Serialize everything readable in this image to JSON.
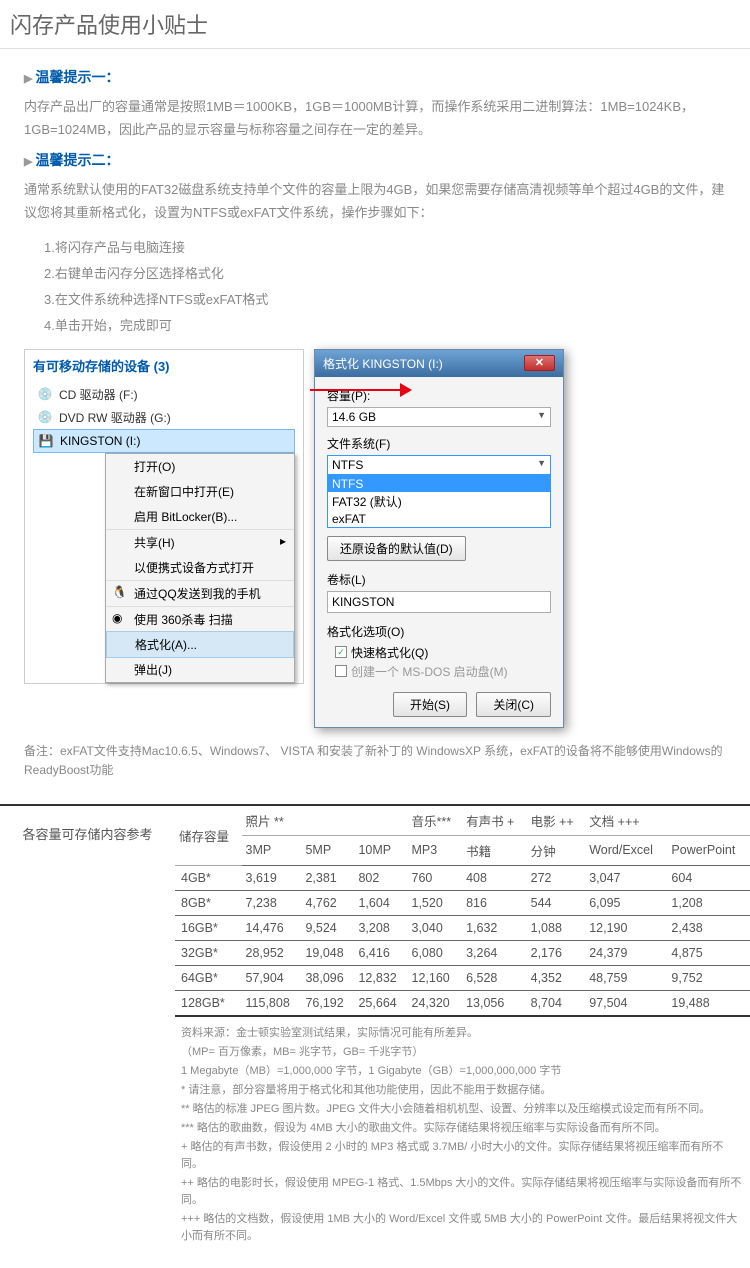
{
  "title": "闪存产品使用小贴士",
  "tip1_header": "温馨提示一：",
  "tip1_body": "内存产品出厂的容量通常是按照1MB＝1000KB，1GB＝1000MB计算，而操作系统采用二进制算法：1MB=1024KB，1GB=1024MB，因此产品的显示容量与标称容量之间存在一定的差异。",
  "tip2_header": "温馨提示二：",
  "tip2_body": "通常系统默认使用的FAT32磁盘系统支持单个文件的容量上限为4GB，如果您需要存储高清视频等单个超过4GB的文件，建议您将其重新格式化，设置为NTFS或exFAT文件系统，操作步骤如下：",
  "steps": [
    "1.将闪存产品与电脑连接",
    "2.右键单击闪存分区选择格式化",
    "3.在文件系统种选择NTFS或exFAT格式",
    "4.单击开始，完成即可"
  ],
  "devices_header": "有可移动存储的设备 (3)",
  "devices": [
    {
      "icon": "💿",
      "label": "CD 驱动器 (F:)"
    },
    {
      "icon": "💿",
      "label": "DVD RW 驱动器 (G:)"
    },
    {
      "icon": "💾",
      "label": "KINGSTON (I:)",
      "selected": true
    }
  ],
  "context_menu": [
    {
      "label": "打开(O)"
    },
    {
      "label": "在新窗口中打开(E)"
    },
    {
      "label": "启用 BitLocker(B)..."
    },
    {
      "label": "共享(H)",
      "arrow": "▸",
      "sep": true
    },
    {
      "label": "以便携式设备方式打开"
    },
    {
      "label": "通过QQ发送到我的手机",
      "icon": "🐧",
      "sep": true
    },
    {
      "label": "使用 360杀毒 扫描",
      "icon": "◉",
      "sep": true
    },
    {
      "label": "格式化(A)...",
      "highlight": true,
      "sep": true
    },
    {
      "label": "弹出(J)"
    }
  ],
  "dialog": {
    "title": "格式化 KINGSTON (I:)",
    "capacity_label": "容量(P):",
    "capacity_value": "14.6 GB",
    "fs_label": "文件系统(F)",
    "fs_value": "NTFS",
    "fs_options": [
      "NTFS",
      "FAT32 (默认)",
      "exFAT"
    ],
    "restore": "还原设备的默认值(D)",
    "volume_label": "卷标(L)",
    "volume_value": "KINGSTON",
    "options_label": "格式化选项(O)",
    "quick_format": "快速格式化(Q)",
    "quick_checked": true,
    "msdos": "创建一个 MS-DOS 启动盘(M)",
    "msdos_checked": false,
    "start": "开始(S)",
    "close": "关闭(C)"
  },
  "remark": "备注：exFAT文件支持Mac10.6.5、Windows7、 VISTA  和安装了新补丁的 WindowsXP 系统，exFAT的设备将不能够使用Windows的ReadyBoost功能",
  "table_label": "各容量可存储内容参考",
  "table": {
    "col0": "储存容量",
    "cats": [
      {
        "label": "照片 **",
        "sub": [
          "3MP",
          "5MP",
          "10MP"
        ]
      },
      {
        "label": "音乐***",
        "sub": [
          "MP3"
        ]
      },
      {
        "label": "有声书 +",
        "sub": [
          "书籍"
        ]
      },
      {
        "label": "电影 ++",
        "sub": [
          "分钟"
        ]
      },
      {
        "label": "文档 +++",
        "sub": [
          "Word/Excel",
          "PowerPoint"
        ]
      }
    ],
    "rows": [
      {
        "cap": "4GB*",
        "v": [
          "3,619",
          "2,381",
          "802",
          "760",
          "408",
          "272",
          "3,047",
          "604"
        ]
      },
      {
        "cap": "8GB*",
        "v": [
          "7,238",
          "4,762",
          "1,604",
          "1,520",
          "816",
          "544",
          "6,095",
          "1,208"
        ]
      },
      {
        "cap": "16GB*",
        "v": [
          "14,476",
          "9,524",
          "3,208",
          "3,040",
          "1,632",
          "1,088",
          "12,190",
          "2,438"
        ]
      },
      {
        "cap": "32GB*",
        "v": [
          "28,952",
          "19,048",
          "6,416",
          "6,080",
          "3,264",
          "2,176",
          "24,379",
          "4,875"
        ]
      },
      {
        "cap": "64GB*",
        "v": [
          "57,904",
          "38,096",
          "12,832",
          "12,160",
          "6,528",
          "4,352",
          "48,759",
          "9,752"
        ]
      },
      {
        "cap": "128GB*",
        "v": [
          "115,808",
          "76,192",
          "25,664",
          "24,320",
          "13,056",
          "8,704",
          "97,504",
          "19,488"
        ]
      }
    ]
  },
  "footnotes": [
    "资料来源：金士顿实验室测试结果，实际情况可能有所差异。",
    "（MP= 百万像素，MB= 兆字节，GB= 千兆字节）",
    "1 Megabyte（MB）=1,000,000 字节，1 Gigabyte（GB）=1,000,000,000 字节",
    "* 请注意，部分容量将用于格式化和其他功能使用，因此不能用于数据存储。",
    "** 略估的标准 JPEG 图片数。JPEG 文件大小会随着相机机型、设置、分辨率以及压缩模式设定而有所不同。",
    "*** 略估的歌曲数，假设为 4MB 大小的歌曲文件。实际存储结果将视压缩率与实际设备而有所不同。",
    "+ 略估的有声书数，假设使用 2 小时的 MP3 格式或 3.7MB/ 小时大小的文件。实际存储结果将视压缩率而有所不同。",
    "++ 略估的电影时长，假设使用 MPEG-1 格式、1.5Mbps 大小的文件。实际存储结果将视压缩率与实际设备而有所不同。",
    "+++ 略估的文档数，假设使用 1MB 大小的 Word/Excel 文件或 5MB 大小的 PowerPoint 文件。最后结果将视文件大小而有所不同。"
  ]
}
